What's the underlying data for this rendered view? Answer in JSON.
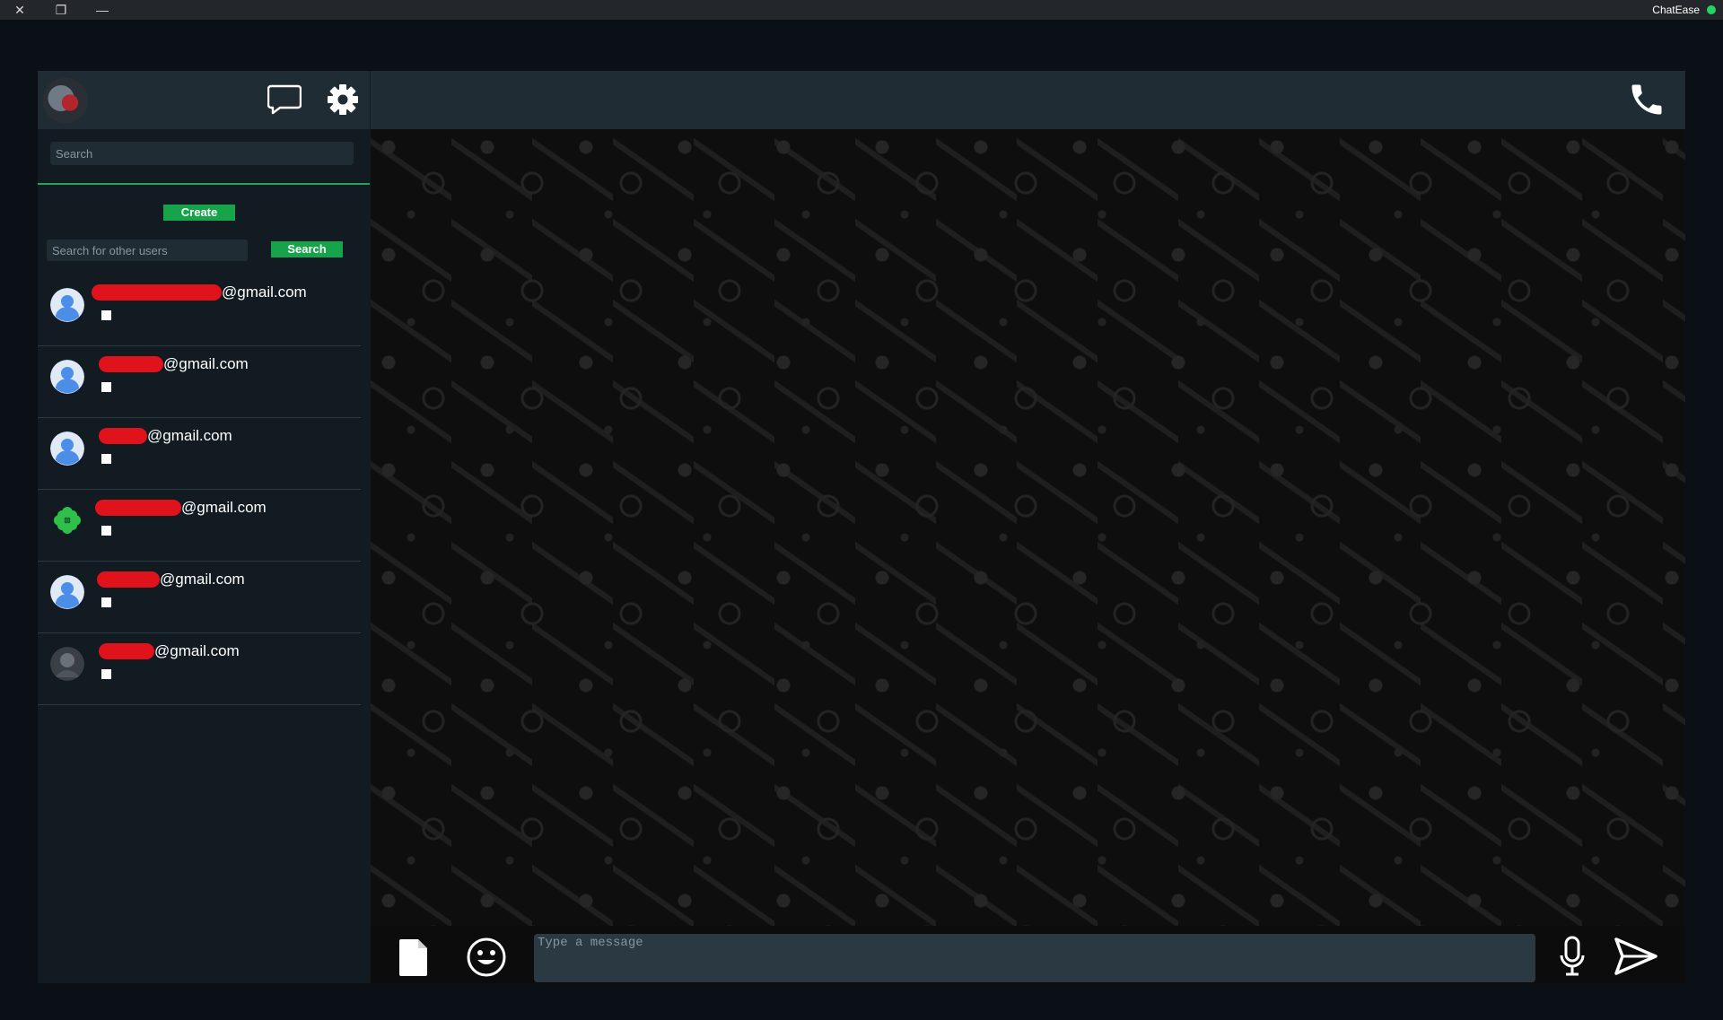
{
  "window": {
    "title": "ChatEase",
    "close_symbol": "✕",
    "restore_symbol": "❐",
    "minimize_symbol": "—"
  },
  "sidebar": {
    "search_placeholder": "Search",
    "create_label": "Create",
    "user_search_placeholder": "Search for other users",
    "user_search_button": "Search",
    "contacts": [
      {
        "email_suffix": "@gmail.com",
        "avatar": "default-user-icon",
        "redaction": "redacted"
      },
      {
        "email_suffix": "@gmail.com",
        "avatar": "default-user-icon",
        "redaction": "redacted"
      },
      {
        "email_suffix": "@gmail.com",
        "avatar": "default-user-icon",
        "redaction": "redacted"
      },
      {
        "email_suffix": "@gmail.com",
        "avatar": "clover-icon",
        "redaction": "redacted"
      },
      {
        "email_suffix": "@gmail.com",
        "avatar": "default-user-icon",
        "redaction": "redacted"
      },
      {
        "email_suffix": "@gmail.com",
        "avatar": "photo-avatar",
        "redaction": "redacted"
      }
    ]
  },
  "chat": {
    "message_placeholder": "Type a message"
  },
  "colors": {
    "accent": "#16a34a",
    "panel": "#202c33",
    "background": "#111b21",
    "redaction": "#e0121b"
  }
}
